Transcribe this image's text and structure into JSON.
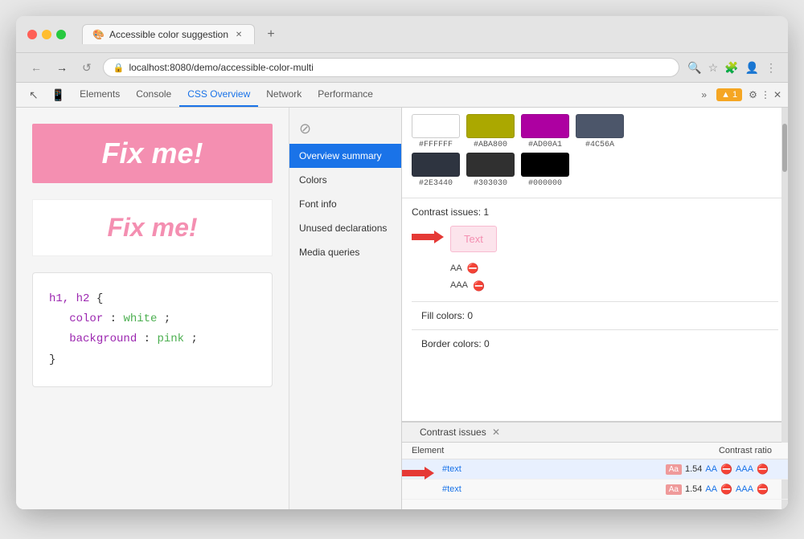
{
  "browser": {
    "tab_title": "Accessible color suggestion",
    "url": "localhost:8080/demo/accessible-color-multi",
    "nav": {
      "back": "←",
      "forward": "→",
      "reload": "↺"
    }
  },
  "devtools": {
    "tabs": [
      "Elements",
      "Console",
      "CSS Overview",
      "Network",
      "Performance"
    ],
    "active_tab": "CSS Overview",
    "warning_count": "▲ 1",
    "more": "»"
  },
  "sidebar": {
    "items": [
      {
        "label": "Overview summary",
        "active": true
      },
      {
        "label": "Colors",
        "active": false
      },
      {
        "label": "Font info",
        "active": false
      },
      {
        "label": "Unused declarations",
        "active": false
      },
      {
        "label": "Media queries",
        "active": false
      }
    ]
  },
  "color_swatches": [
    {
      "hex": "#FFFFFF",
      "color": "#FFFFFF"
    },
    {
      "hex": "#ABA800",
      "color": "#ABA800"
    },
    {
      "hex": "#AD00A1",
      "color": "#AD00A1"
    },
    {
      "hex": "#4C56A",
      "color": "#4C56A"
    }
  ],
  "dark_swatches": [
    {
      "hex": "#2E3440",
      "color": "#2E3440"
    },
    {
      "hex": "#303030",
      "color": "#303030"
    },
    {
      "hex": "#000000",
      "color": "#000000"
    }
  ],
  "contrast": {
    "title": "Contrast issues: 1",
    "preview_text": "Text",
    "ratings": [
      {
        "label": "AA",
        "pass": false
      },
      {
        "label": "AAA",
        "pass": false
      }
    ],
    "fill_colors": "Fill colors: 0",
    "border_colors": "Border colors: 0"
  },
  "bottom_panel": {
    "tab_label": "Contrast issues",
    "columns": [
      "Element",
      "Contrast ratio"
    ],
    "rows": [
      {
        "element": "#text",
        "ratio": "1.54",
        "aa": "AA",
        "aaa": "AAA"
      },
      {
        "element": "#text",
        "ratio": "1.54",
        "aa": "AA",
        "aaa": "AAA"
      }
    ]
  },
  "page": {
    "fix_me_label": "Fix me!",
    "code_lines": [
      "h1, h2 {",
      "  color: white;",
      "  background: pink;",
      "}"
    ]
  }
}
